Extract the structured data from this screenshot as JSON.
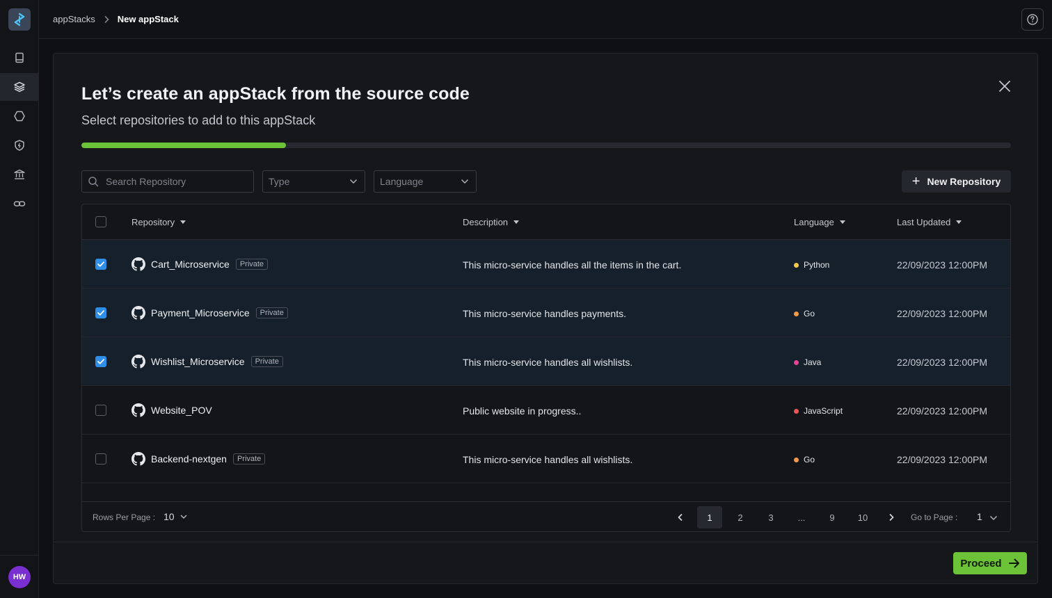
{
  "sidebar": {
    "logo": "appstack-logo-icon",
    "items": [
      {
        "icon": "book-icon",
        "active": false
      },
      {
        "icon": "layers-icon",
        "active": true
      },
      {
        "icon": "hexagon-icon",
        "active": false
      },
      {
        "icon": "shield-icon",
        "active": false
      },
      {
        "icon": "bank-icon",
        "active": false
      },
      {
        "icon": "link-icon",
        "active": false
      }
    ],
    "avatar_initials": "HW"
  },
  "topbar": {
    "breadcrumb": [
      "appStacks",
      "New appStack"
    ],
    "help_icon": "help-circle-icon"
  },
  "modal": {
    "title": "Let’s create an appStack from the source code",
    "subtitle": "Select repositories to add to this appStack",
    "progress_percent": 22,
    "search_placeholder": "Search Repository",
    "type_placeholder": "Type",
    "language_placeholder": "Language",
    "new_repo_label": "New Repository",
    "proceed_label": "Proceed"
  },
  "table": {
    "headers": {
      "repository": "Repository",
      "description": "Description",
      "language": "Language",
      "last_updated": "Last Updated"
    },
    "rows": [
      {
        "name": "Cart_Microservice",
        "badge": "Private",
        "description": "This micro-service handles all the items in the cart.",
        "language": "Python",
        "updated": "22/09/2023 12:00PM",
        "checked": true
      },
      {
        "name": "Payment_Microservice",
        "badge": "Private",
        "description": "This micro-service handles payments.",
        "language": "Go",
        "updated": "22/09/2023 12:00PM",
        "checked": true
      },
      {
        "name": "Wishlist_Microservice",
        "badge": "Private",
        "description": "This micro-service handles all wishlists.",
        "language": "Java",
        "updated": "22/09/2023 12:00PM",
        "checked": true
      },
      {
        "name": "Website_POV",
        "badge": "",
        "description": "Public website in progress..",
        "language": "JavaScript",
        "updated": "22/09/2023 12:00PM",
        "checked": false
      },
      {
        "name": "Backend-nextgen",
        "badge": "Private",
        "description": "This micro-service handles all wishlists.",
        "language": "Go",
        "updated": "22/09/2023 12:00PM",
        "checked": false
      }
    ],
    "language_colors": {
      "Python": "#f2c94c",
      "Go": "#f2994a",
      "Java": "#e84393",
      "JavaScript": "#eb5757"
    }
  },
  "pagination": {
    "rows_per_page_label": "Rows Per Page :",
    "rows_per_page": "10",
    "pages": [
      "1",
      "2",
      "3",
      "...",
      "9",
      "10"
    ],
    "current_page": "1",
    "goto_label": "Go to Page :",
    "goto_value": "1"
  }
}
